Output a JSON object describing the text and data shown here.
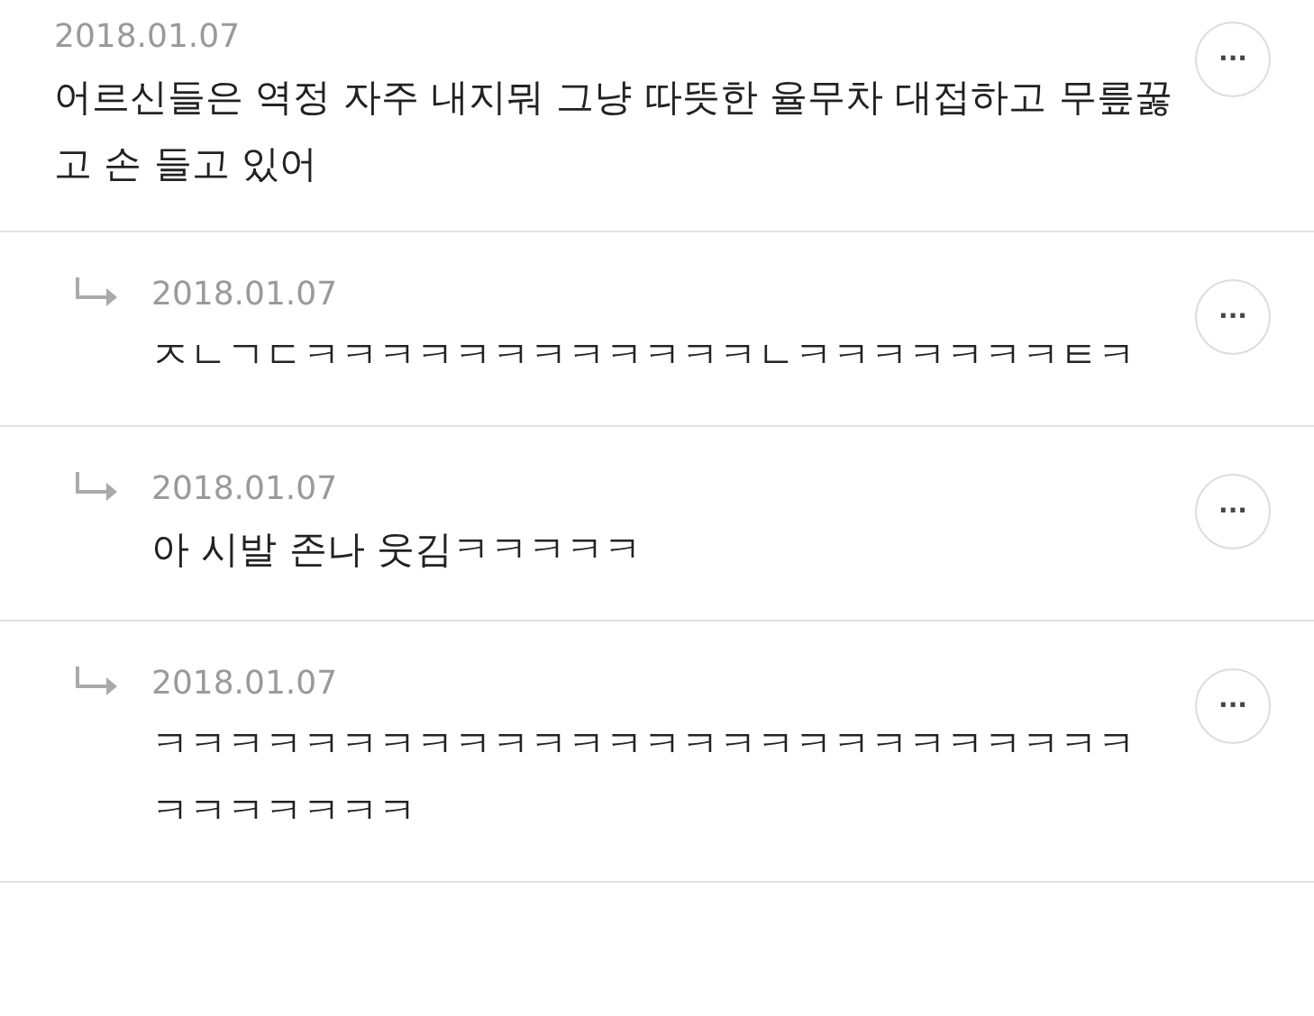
{
  "comments": [
    {
      "kind": "comment",
      "date": "2018.01.07",
      "text": "어르신들은 역정 자주 내지뭐 그냥 따뜻한 율무차 대접하고 무릎꿇고 손 들고 있어"
    },
    {
      "kind": "reply",
      "date": "2018.01.07",
      "text": "ㅈㄴㄱㄷㅋㅋㅋㅋㅋㅋㅋㅋㅋㅋㅋㅋㄴㅋㅋㅋㅋㅋㅋㅋㅌㅋ"
    },
    {
      "kind": "reply",
      "date": "2018.01.07",
      "text": "아 시발 존나 웃김ㅋㅋㅋㅋㅋ"
    },
    {
      "kind": "reply",
      "date": "2018.01.07",
      "text": "ㅋㅋㅋㅋㅋㅋㅋㅋㅋㅋㅋㅋㅋㅋㅋㅋㅋㅋㅋㅋㅋㅋㅋㅋㅋㅋㅋㅋㅋㅋㅋㅋㅋ"
    }
  ],
  "more_label": "···"
}
